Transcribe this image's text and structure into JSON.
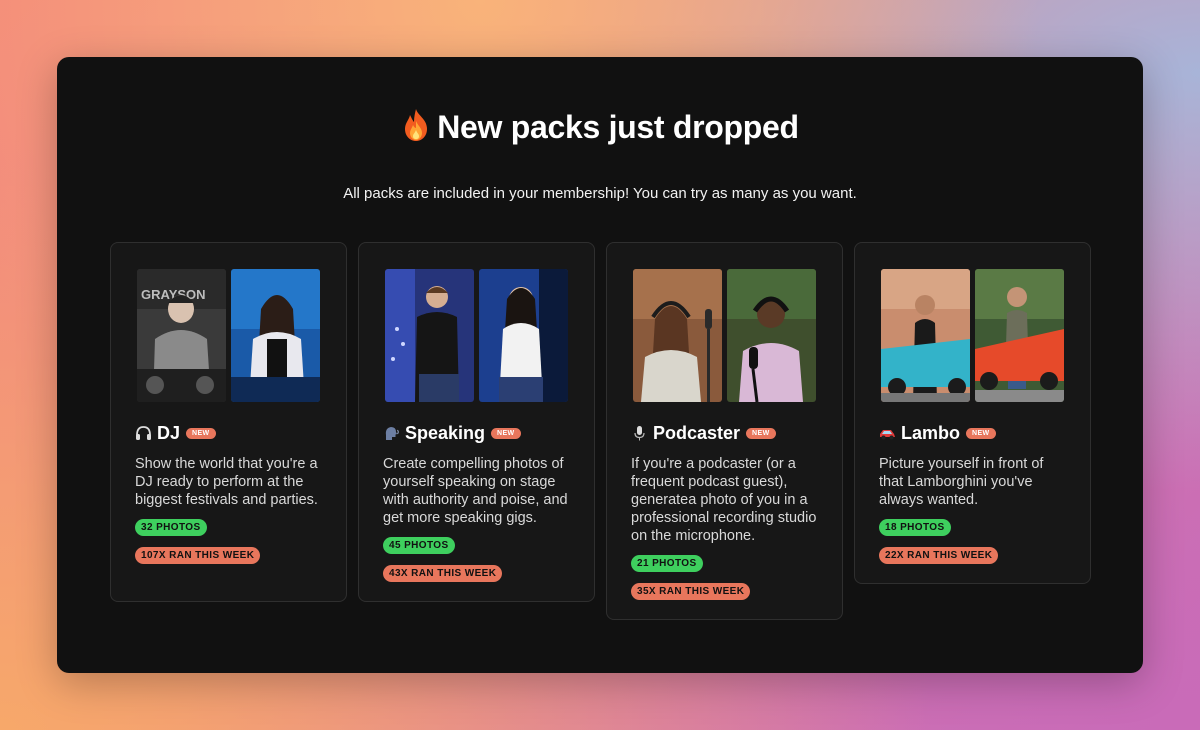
{
  "heading": {
    "icon": "fire-icon",
    "text": "New packs just dropped"
  },
  "subtitle": "All packs are included in your membership! You can try as many as you want.",
  "colors": {
    "panel": "#111111",
    "card": "#171717",
    "badge_new": "#e8765c",
    "photos_pill": "#3ecf5e",
    "ran_pill": "#e8765c"
  },
  "packs": [
    {
      "icon": "headphones-icon",
      "title": "DJ",
      "badge": "NEW",
      "description": "Show the world that you're a DJ ready to perform at the biggest festivals and parties.",
      "photos": "32 PHOTOS",
      "ran": "107X RAN THIS WEEK",
      "photo_sign_text": "GRAYSON"
    },
    {
      "icon": "speaking-head-icon",
      "title": "Speaking",
      "badge": "NEW",
      "description": "Create compelling photos of yourself speaking on stage with authority and poise, and get more speaking gigs.",
      "photos": "45 PHOTOS",
      "ran": "43X RAN THIS WEEK"
    },
    {
      "icon": "microphone-icon",
      "title": "Podcaster",
      "badge": "NEW",
      "description": "If you're a podcaster (or a frequent podcast guest), generatea photo of you in a professional recording studio on the microphone.",
      "photos": "21 PHOTOS",
      "ran": "35X RAN THIS WEEK"
    },
    {
      "icon": "car-icon",
      "title": "Lambo",
      "badge": "NEW",
      "description": "Picture yourself in front of that Lamborghini you've always wanted.",
      "photos": "18 PHOTOS",
      "ran": "22X RAN THIS WEEK"
    }
  ]
}
